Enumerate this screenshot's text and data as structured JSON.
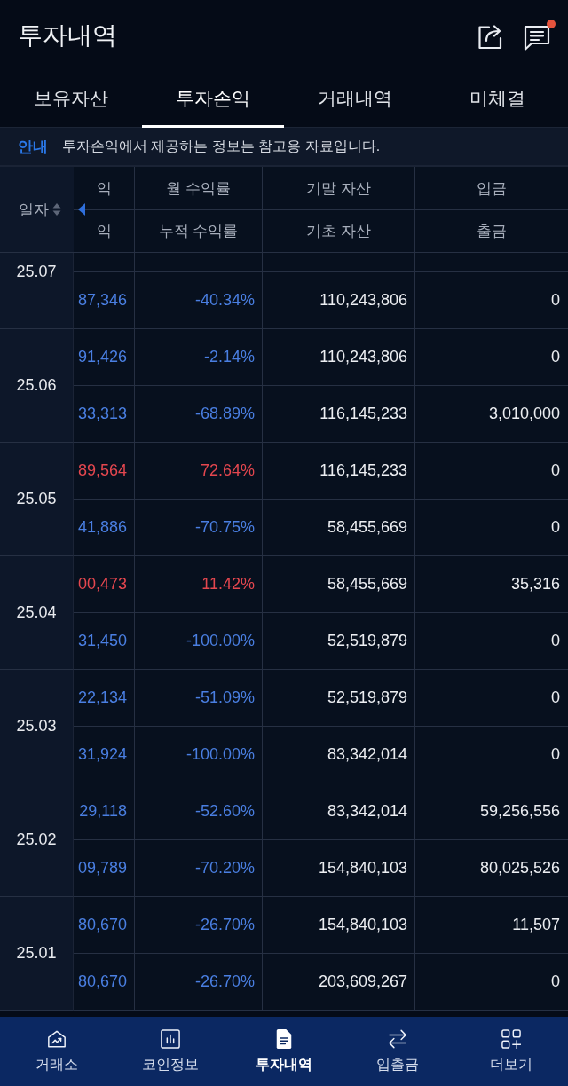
{
  "header": {
    "title": "투자내역",
    "message_unread": true
  },
  "tabs": [
    {
      "label": "보유자산",
      "selected": false
    },
    {
      "label": "투자손익",
      "selected": true
    },
    {
      "label": "거래내역",
      "selected": false
    },
    {
      "label": "미체결",
      "selected": false
    }
  ],
  "notice": {
    "label": "안내",
    "text": "투자손익에서 제공하는 정보는 참고용 자료입니다."
  },
  "table": {
    "date_header": "일자",
    "columns": [
      {
        "top": "익",
        "bottom": "익"
      },
      {
        "top": "월 수익률",
        "bottom": "누적 수익률"
      },
      {
        "top": "기말 자산",
        "bottom": "기초 자산"
      },
      {
        "top": "입금",
        "bottom": "출금"
      }
    ],
    "groups": [
      {
        "date": "25.07",
        "cut_off_top": true,
        "rows": [
          {
            "gain": false,
            "cells": [
              "87,346",
              "-40.34%",
              "110,243,806",
              "0"
            ]
          }
        ]
      },
      {
        "date": "25.06",
        "cut_off_top": false,
        "rows": [
          {
            "gain": false,
            "cells": [
              "91,426",
              "-2.14%",
              "110,243,806",
              "0"
            ]
          },
          {
            "gain": false,
            "cells": [
              "33,313",
              "-68.89%",
              "116,145,233",
              "3,010,000"
            ]
          }
        ]
      },
      {
        "date": "25.05",
        "cut_off_top": false,
        "rows": [
          {
            "gain": true,
            "cells": [
              "89,564",
              "72.64%",
              "116,145,233",
              "0"
            ]
          },
          {
            "gain": false,
            "cells": [
              "41,886",
              "-70.75%",
              "58,455,669",
              "0"
            ]
          }
        ]
      },
      {
        "date": "25.04",
        "cut_off_top": false,
        "rows": [
          {
            "gain": true,
            "cells": [
              "00,473",
              "11.42%",
              "58,455,669",
              "35,316"
            ]
          },
          {
            "gain": false,
            "cells": [
              "31,450",
              "-100.00%",
              "52,519,879",
              "0"
            ]
          }
        ]
      },
      {
        "date": "25.03",
        "cut_off_top": false,
        "rows": [
          {
            "gain": false,
            "cells": [
              "22,134",
              "-51.09%",
              "52,519,879",
              "0"
            ]
          },
          {
            "gain": false,
            "cells": [
              "31,924",
              "-100.00%",
              "83,342,014",
              "0"
            ]
          }
        ]
      },
      {
        "date": "25.02",
        "cut_off_top": false,
        "rows": [
          {
            "gain": false,
            "cells": [
              "29,118",
              "-52.60%",
              "83,342,014",
              "59,256,556"
            ]
          },
          {
            "gain": false,
            "cells": [
              "09,789",
              "-70.20%",
              "154,840,103",
              "80,025,526"
            ]
          }
        ]
      },
      {
        "date": "25.01",
        "cut_off_top": false,
        "rows": [
          {
            "gain": false,
            "cells": [
              "80,670",
              "-26.70%",
              "154,840,103",
              "11,507"
            ]
          },
          {
            "gain": false,
            "cells": [
              "80,670",
              "-26.70%",
              "203,609,267",
              "0"
            ]
          }
        ]
      }
    ]
  },
  "nav": [
    {
      "label": "거래소",
      "selected": false
    },
    {
      "label": "코인정보",
      "selected": false
    },
    {
      "label": "투자내역",
      "selected": true
    },
    {
      "label": "입출금",
      "selected": false
    },
    {
      "label": "더보기",
      "selected": false
    }
  ]
}
